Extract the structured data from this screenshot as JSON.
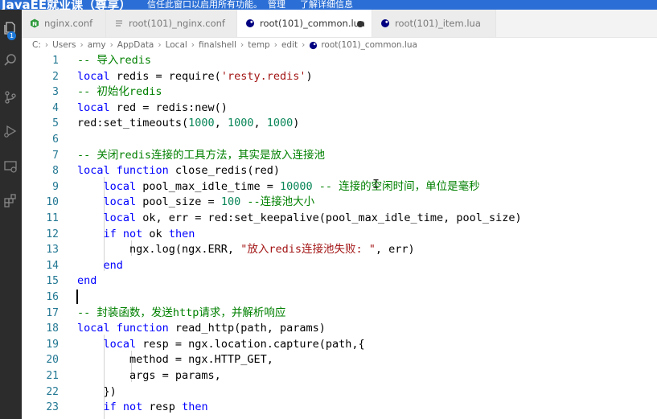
{
  "banner": {
    "course": "JavaEE就业课（尊享）",
    "message": "信任此窗口以启用所有功能。",
    "manage": "管理",
    "details": "了解详细信息"
  },
  "activity": {
    "items": [
      {
        "icon": "files-icon",
        "badge": "1"
      },
      {
        "icon": "search-icon"
      },
      {
        "icon": "source-control-icon"
      },
      {
        "icon": "run-debug-icon"
      },
      {
        "icon": "remote-explorer-icon"
      },
      {
        "icon": "extensions-icon"
      }
    ]
  },
  "tabs": [
    {
      "label": "nginx.conf",
      "icon": "nginx-icon",
      "active": false
    },
    {
      "label": "root(101)_nginx.conf",
      "icon": "file-icon",
      "active": false
    },
    {
      "label": "root(101)_common.lua",
      "icon": "lua-icon",
      "active": true,
      "modified": true
    },
    {
      "label": "root(101)_item.lua",
      "icon": "lua-icon",
      "active": false
    }
  ],
  "breadcrumb": [
    "C:",
    "Users",
    "amy",
    "AppData",
    "Local",
    "finalshell",
    "temp",
    "edit",
    "root(101)_common.lua"
  ],
  "code": {
    "lines": [
      {
        "n": "1",
        "tokens": [
          [
            "cm",
            "-- 导入redis"
          ]
        ]
      },
      {
        "n": "2",
        "tokens": [
          [
            "kw",
            "local"
          ],
          [
            "p",
            " redis = require("
          ],
          [
            "str",
            "'resty.redis'"
          ],
          [
            "p",
            ")"
          ]
        ]
      },
      {
        "n": "3",
        "tokens": [
          [
            "cm",
            "-- 初始化redis"
          ]
        ]
      },
      {
        "n": "4",
        "tokens": [
          [
            "kw",
            "local"
          ],
          [
            "p",
            " red = redis:new()"
          ]
        ]
      },
      {
        "n": "5",
        "tokens": [
          [
            "p",
            "red:set_timeouts("
          ],
          [
            "num",
            "1000"
          ],
          [
            "p",
            ", "
          ],
          [
            "num",
            "1000"
          ],
          [
            "p",
            ", "
          ],
          [
            "num",
            "1000"
          ],
          [
            "p",
            ")"
          ]
        ]
      },
      {
        "n": "6",
        "tokens": []
      },
      {
        "n": "7",
        "tokens": [
          [
            "cm",
            "-- 关闭redis连接的工具方法，其实是放入连接池"
          ]
        ]
      },
      {
        "n": "8",
        "tokens": [
          [
            "kw",
            "local function"
          ],
          [
            "p",
            " close_redis(red)"
          ]
        ]
      },
      {
        "n": "9",
        "tokens": [
          [
            "p",
            "    "
          ],
          [
            "kw",
            "local"
          ],
          [
            "p",
            " pool_max_idle_time = "
          ],
          [
            "num",
            "10000"
          ],
          [
            "p",
            " "
          ],
          [
            "cm",
            "-- 连接的空闲时间，单位是毫秒"
          ]
        ]
      },
      {
        "n": "10",
        "tokens": [
          [
            "p",
            "    "
          ],
          [
            "kw",
            "local"
          ],
          [
            "p",
            " pool_size = "
          ],
          [
            "num",
            "100"
          ],
          [
            "p",
            " "
          ],
          [
            "cm",
            "--连接池大小"
          ]
        ]
      },
      {
        "n": "11",
        "tokens": [
          [
            "p",
            "    "
          ],
          [
            "kw",
            "local"
          ],
          [
            "p",
            " ok, err = red:set_keepalive(pool_max_idle_time, pool_size)"
          ]
        ]
      },
      {
        "n": "12",
        "tokens": [
          [
            "p",
            "    "
          ],
          [
            "kw",
            "if not"
          ],
          [
            "p",
            " ok "
          ],
          [
            "kw",
            "then"
          ]
        ]
      },
      {
        "n": "13",
        "tokens": [
          [
            "p",
            "        ngx.log(ngx.ERR, "
          ],
          [
            "str",
            "\"放入redis连接池失败: \""
          ],
          [
            "p",
            ", err)"
          ]
        ]
      },
      {
        "n": "14",
        "tokens": [
          [
            "p",
            "    "
          ],
          [
            "kw",
            "end"
          ]
        ]
      },
      {
        "n": "15",
        "tokens": [
          [
            "kw",
            "end"
          ]
        ]
      },
      {
        "n": "16",
        "tokens": []
      },
      {
        "n": "17",
        "tokens": [
          [
            "cm",
            "-- 封装函数，发送http请求，并解析响应"
          ]
        ]
      },
      {
        "n": "18",
        "tokens": [
          [
            "kw",
            "local function"
          ],
          [
            "p",
            " read_http(path, params)"
          ]
        ]
      },
      {
        "n": "19",
        "tokens": [
          [
            "p",
            "    "
          ],
          [
            "kw",
            "local"
          ],
          [
            "p",
            " resp = ngx.location.capture(path,{"
          ]
        ]
      },
      {
        "n": "20",
        "tokens": [
          [
            "p",
            "        method = ngx.HTTP_GET,"
          ]
        ]
      },
      {
        "n": "21",
        "tokens": [
          [
            "p",
            "        args = params,"
          ]
        ]
      },
      {
        "n": "22",
        "tokens": [
          [
            "p",
            "    })"
          ]
        ]
      },
      {
        "n": "23",
        "tokens": [
          [
            "p",
            "    "
          ],
          [
            "kw",
            "if not"
          ],
          [
            "p",
            " resp "
          ],
          [
            "kw",
            "then"
          ]
        ]
      }
    ]
  }
}
